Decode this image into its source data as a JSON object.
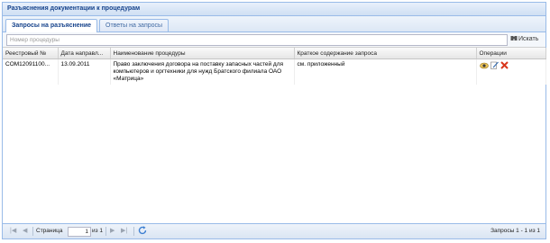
{
  "panel": {
    "title": "Разъяснения документации к процедурам"
  },
  "tabs": [
    {
      "label": "Запросы на разъяснение",
      "active": true
    },
    {
      "label": "Ответы на запросы",
      "active": false
    }
  ],
  "search": {
    "placeholder": "Номер процедуры",
    "button_label": "Искать"
  },
  "table": {
    "columns": [
      "Реестровый №",
      "Дата направл...",
      "Наименование процедуры",
      "Краткое содержание запроса",
      "Операции"
    ],
    "rows": [
      {
        "reg_number": "COM12091100...",
        "date": "13.09.2011",
        "procedure_name": "Право заключения договора на поставку запасных частей для компьютеров и оргтехники для нужд Братского филиала ОАО «Матрица»",
        "summary": "см. приложенный",
        "operations": [
          "view-icon",
          "edit-icon",
          "delete-icon"
        ]
      }
    ]
  },
  "pager": {
    "page_label": "Страница",
    "page_value": "1",
    "of_label": "из 1",
    "status": "Запросы 1 - 1 из 1"
  }
}
